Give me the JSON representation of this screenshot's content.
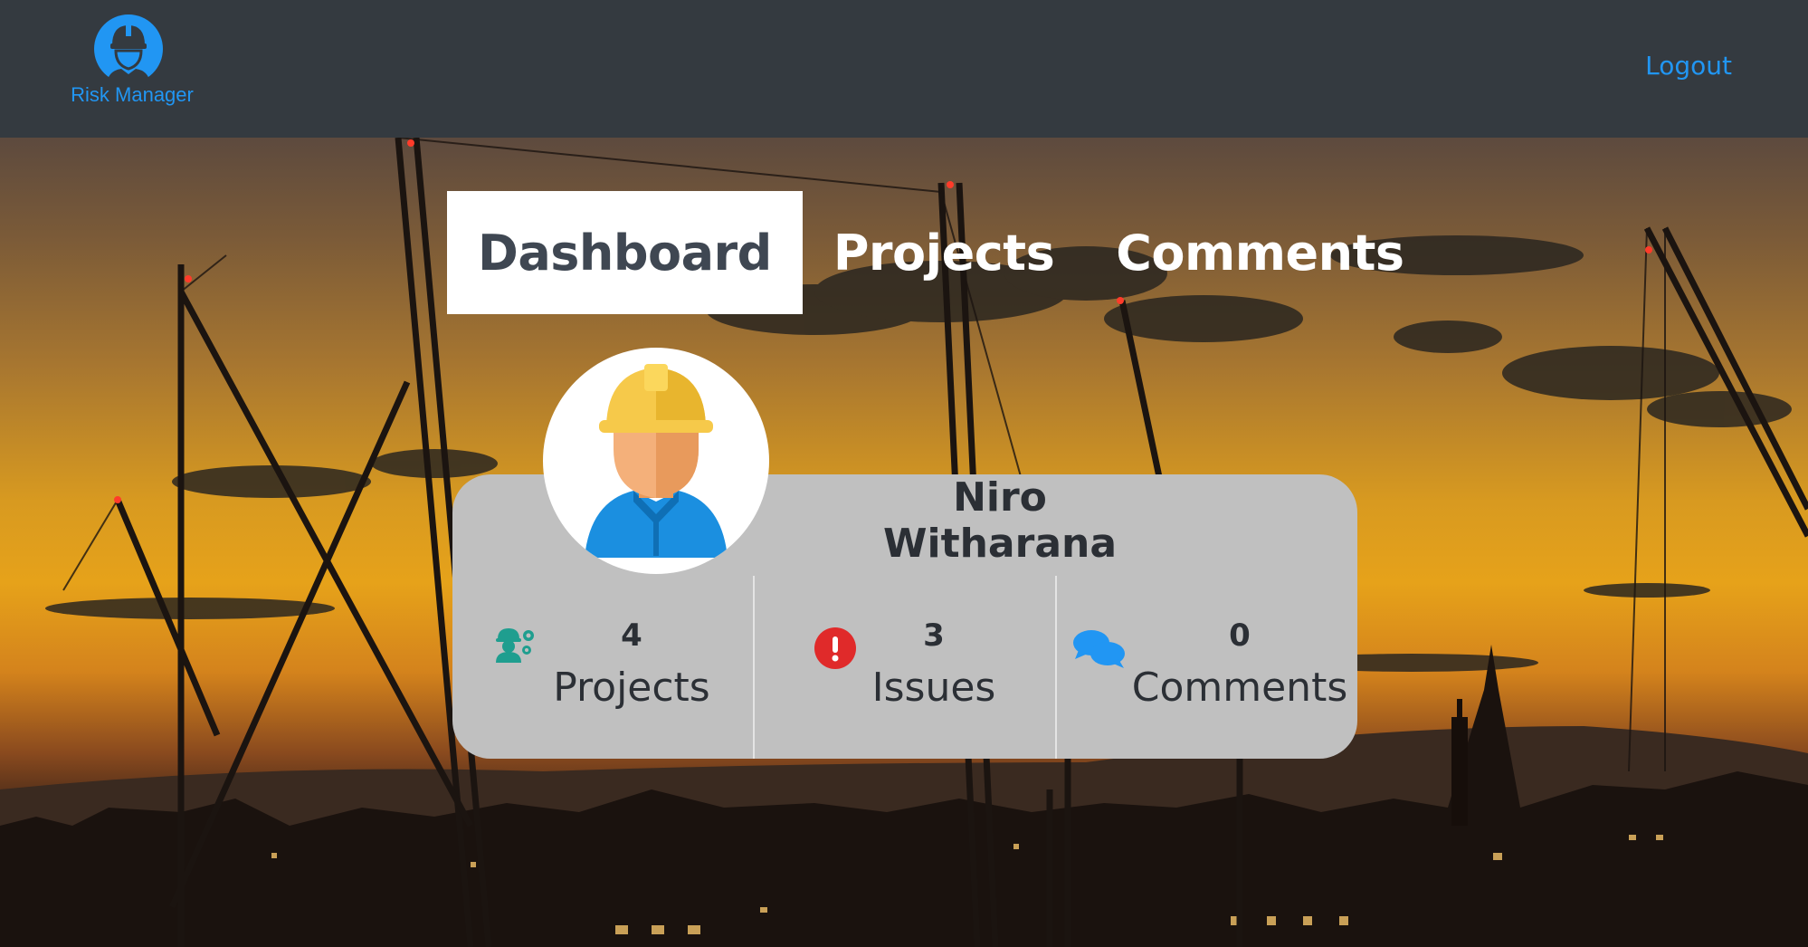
{
  "app": {
    "brand_name": "Risk Manager",
    "logout_label": "Logout",
    "accent_color": "#2196f3",
    "navbar_color": "#343a40"
  },
  "tabs": [
    {
      "label": "Dashboard",
      "active": true
    },
    {
      "label": "Projects",
      "active": false
    },
    {
      "label": "Comments",
      "active": false
    }
  ],
  "profile": {
    "name": "Niro Witharana",
    "avatar_icon": "construction-worker-avatar-icon"
  },
  "stats": [
    {
      "count": "4",
      "label": "Projects",
      "icon": "worker-gears-icon",
      "icon_color": "#1f9e8f"
    },
    {
      "count": "3",
      "label": "Issues",
      "icon": "exclamation-circle-icon",
      "icon_color": "#e02a2a"
    },
    {
      "count": "0",
      "label": "Comments",
      "icon": "comments-icon",
      "icon_color": "#2196f3"
    }
  ]
}
